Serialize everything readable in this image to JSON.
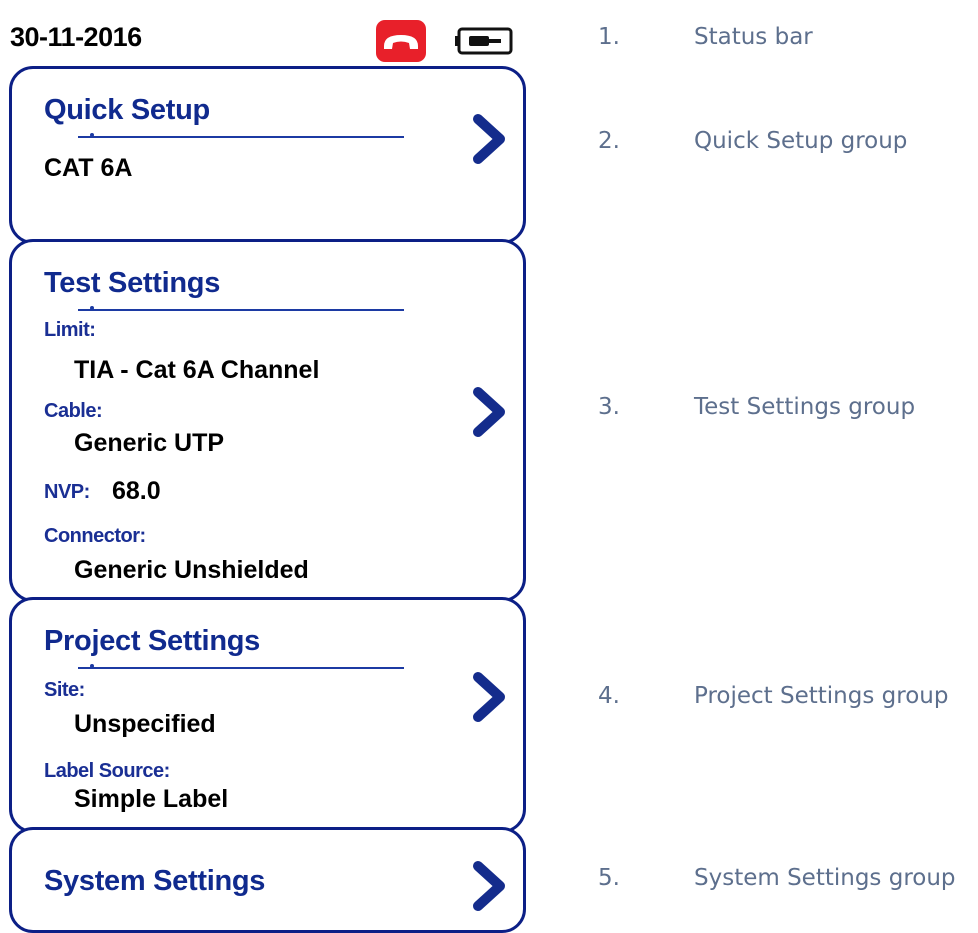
{
  "status_bar": {
    "date": "30-11-2016",
    "icons": [
      "hangup-phone-icon",
      "battery-icon"
    ],
    "hangup_color": "#e8202a"
  },
  "groups": {
    "quick_setup": {
      "title": "Quick Setup",
      "value": "CAT 6A",
      "icon": "chevron-right-icon"
    },
    "test_settings": {
      "title": "Test Settings",
      "limit_label": "Limit:",
      "limit_value": "TIA - Cat 6A Channel",
      "cable_label": "Cable:",
      "cable_value": "Generic UTP",
      "nvp_label": "NVP:",
      "nvp_value": "68.0",
      "connector_label": "Connector:",
      "connector_value": "Generic Unshielded",
      "icon": "chevron-right-icon"
    },
    "project_settings": {
      "title": "Project Settings",
      "site_label": "Site:",
      "site_value": "Unspecified",
      "label_source_label": "Label Source:",
      "label_source_value": "Simple Label",
      "icon": "chevron-right-icon"
    },
    "system_settings": {
      "title": "System Settings",
      "icon": "chevron-right-icon"
    }
  },
  "legend": [
    {
      "num": "1.",
      "text": "Status bar"
    },
    {
      "num": "2.",
      "text": "Quick Setup group"
    },
    {
      "num": "3.",
      "text": "Test Settings group"
    },
    {
      "num": "4.",
      "text": "Project Settings group"
    },
    {
      "num": "5.",
      "text": "System Settings group"
    }
  ],
  "colors": {
    "group_border": "#0c1f86",
    "group_title": "#102a8e",
    "field_label": "#1a2f94",
    "chevron": "#142c8c",
    "legend_text": "#5d6f8d"
  }
}
